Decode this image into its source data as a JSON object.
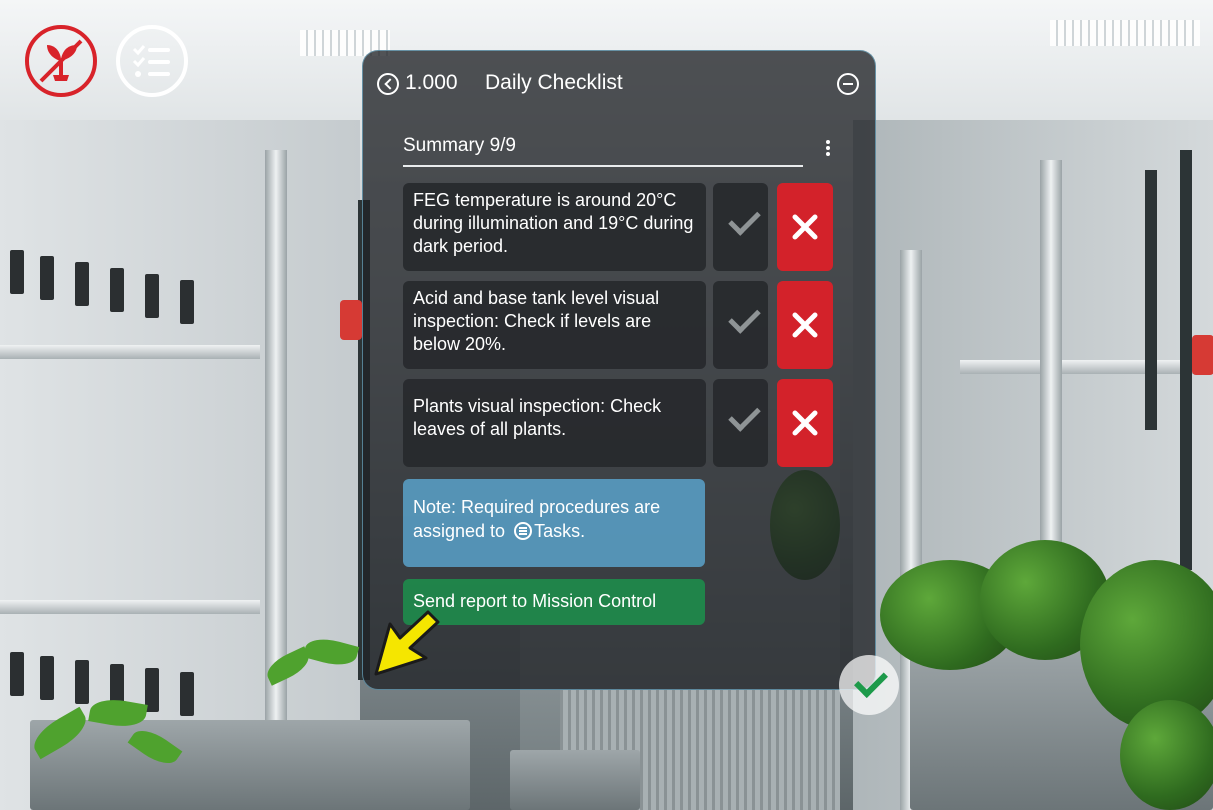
{
  "header": {
    "step_number": "1.000",
    "title": "Daily Checklist"
  },
  "summary": {
    "label": "Summary 9/9"
  },
  "checklist": {
    "items": [
      {
        "text": "FEG temperature is around 20°C during illumination and 19°C during dark period."
      },
      {
        "text": "Acid and base tank level visual inspection: Check if levels are below 20%."
      },
      {
        "text": "Plants visual inspection: Check leaves of all plants."
      }
    ]
  },
  "note": {
    "text_before": "Note: Required procedures are assigned to",
    "link_label": "Tasks."
  },
  "actions": {
    "send_label": "Send report to Mission Control"
  },
  "icons": {
    "top_left": [
      "plant-icon",
      "checklist-icon"
    ],
    "header": [
      "back-icon",
      "minimize-icon",
      "more-options-icon"
    ],
    "row": [
      "check-icon",
      "close-icon"
    ],
    "overlay": [
      "pointer-cursor-icon",
      "confirm-check-icon"
    ]
  },
  "colors": {
    "reject": "#d3222a",
    "send": "#1e8c4b",
    "note": "#5caad6",
    "plant_icon": "#d8232a",
    "cursor": "#f5e600"
  }
}
